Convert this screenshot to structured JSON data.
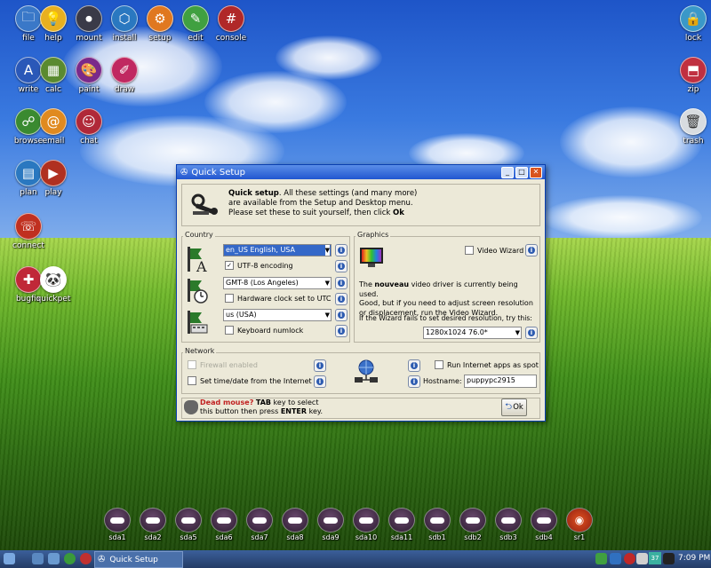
{
  "desktop": {
    "left_icons": [
      {
        "id": "file",
        "label": "file",
        "color": "#3a78c8",
        "glyph": "🗀"
      },
      {
        "id": "help",
        "label": "help",
        "color": "#e8b020",
        "glyph": "💡"
      },
      {
        "id": "mount",
        "label": "mount",
        "color": "#3a3a48",
        "glyph": "⏺"
      },
      {
        "id": "install",
        "label": "install",
        "color": "#2a78c0",
        "glyph": "⬡"
      },
      {
        "id": "setup",
        "label": "setup",
        "color": "#e07820",
        "glyph": "⚙"
      },
      {
        "id": "edit",
        "label": "edit",
        "color": "#40a040",
        "glyph": "✎"
      },
      {
        "id": "console",
        "label": "console",
        "color": "#b02828",
        "glyph": "#"
      },
      {
        "id": "write",
        "label": "write",
        "color": "#2a58b8",
        "glyph": "A"
      },
      {
        "id": "calc",
        "label": "calc",
        "color": "#5a8a30",
        "glyph": "▦"
      },
      {
        "id": "paint",
        "label": "paint",
        "color": "#7a2a8a",
        "glyph": "🎨"
      },
      {
        "id": "draw",
        "label": "draw",
        "color": "#c02860",
        "glyph": "✐"
      },
      {
        "id": "browse",
        "label": "browse",
        "color": "#3a8a30",
        "glyph": "☍"
      },
      {
        "id": "email",
        "label": "email",
        "color": "#e08a20",
        "glyph": "@"
      },
      {
        "id": "chat",
        "label": "chat",
        "color": "#b02838",
        "glyph": "☺"
      },
      {
        "id": "plan",
        "label": "plan",
        "color": "#2a78c0",
        "glyph": "▤"
      },
      {
        "id": "play",
        "label": "play",
        "color": "#b03020",
        "glyph": "▶"
      },
      {
        "id": "connect",
        "label": "connect",
        "color": "#c03020",
        "glyph": "☏"
      },
      {
        "id": "bugfix",
        "label": "bugfix",
        "color": "#c02838",
        "glyph": "✚"
      },
      {
        "id": "quickpet",
        "label": "quickpet",
        "color": "#ffffff",
        "glyph": "🐼"
      }
    ],
    "right_icons": [
      {
        "id": "lock",
        "label": "lock",
        "color": "#3a98c8",
        "glyph": "🔒"
      },
      {
        "id": "zip",
        "label": "zip",
        "color": "#c03040",
        "glyph": "⬒"
      },
      {
        "id": "trash",
        "label": "trash",
        "color": "#d8dce0",
        "glyph": "🗑"
      }
    ],
    "drives": [
      "sda1",
      "sda2",
      "sda5",
      "sda6",
      "sda7",
      "sda8",
      "sda9",
      "sda10",
      "sda11",
      "sdb1",
      "sdb2",
      "sdb3",
      "sdb4",
      "sr1"
    ]
  },
  "window": {
    "title": "Quick Setup",
    "header": {
      "bold": "Quick setup",
      "text1": ". All these settings (and many more)",
      "text2": "are available from the Setup and Desktop menu.",
      "text3": "Please set these to suit yourself, then click ",
      "ok_word": "Ok"
    },
    "country": {
      "label": "Country",
      "locale": "en_US      English, USA",
      "utf8": "UTF-8 encoding",
      "timezone": "GMT-8      (Los Angeles)",
      "hwclock": "Hardware clock set to UTC",
      "keyboard": "us              (USA)",
      "numlock": "Keyboard numlock"
    },
    "graphics": {
      "label": "Graphics",
      "video_wizard": "Video Wizard",
      "desc_pre": "The ",
      "desc_bold": "nouveau",
      "desc_l1": " video driver is currently being used.",
      "desc_l2": "Good, but if you need to adjust screen resolution",
      "desc_l3": "or displacement, run the Video Wizard.",
      "fail_text": "If the Wizard fails to set desired resolution, try this:",
      "resolution": "1280x1024      76.0*"
    },
    "network": {
      "label": "Network",
      "firewall": "Firewall enabled",
      "timedate": "Set time/date from the Internet",
      "spot": "Run Internet apps as spot",
      "hostname_label": "Hostname:",
      "hostname": "puppypc2915"
    },
    "footer": {
      "dead_mouse": "Dead mouse?",
      "tab": "TAB",
      "line1_rest": " key to select",
      "line2_pre": "this button then press ",
      "enter": "ENTER",
      "line2_post": " key.",
      "ok_button": "Ok"
    }
  },
  "taskbar": {
    "task_label": "Quick Setup",
    "temp": "37",
    "clock": "7:09 PM"
  }
}
